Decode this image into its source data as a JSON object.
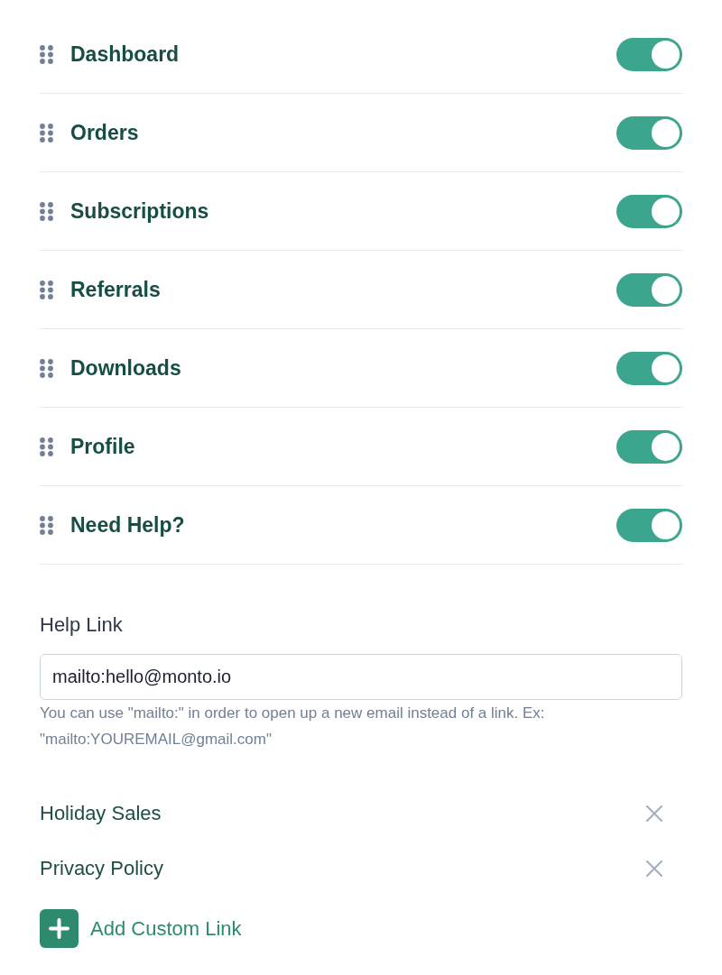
{
  "menu_items": [
    {
      "label": "Dashboard",
      "on": true
    },
    {
      "label": "Orders",
      "on": true
    },
    {
      "label": "Subscriptions",
      "on": true
    },
    {
      "label": "Referrals",
      "on": true
    },
    {
      "label": "Downloads",
      "on": true
    },
    {
      "label": "Profile",
      "on": true
    },
    {
      "label": "Need Help?",
      "on": true
    }
  ],
  "help_link": {
    "label": "Help Link",
    "value": "mailto:hello@monto.io",
    "hint": "You can use \"mailto:\" in order to open up a new email instead of a link. Ex: \"mailto:YOUREMAIL@gmail.com\""
  },
  "custom_links": [
    {
      "label": "Holiday Sales"
    },
    {
      "label": "Privacy Policy"
    }
  ],
  "add_link_button": {
    "label": "Add Custom Link"
  }
}
